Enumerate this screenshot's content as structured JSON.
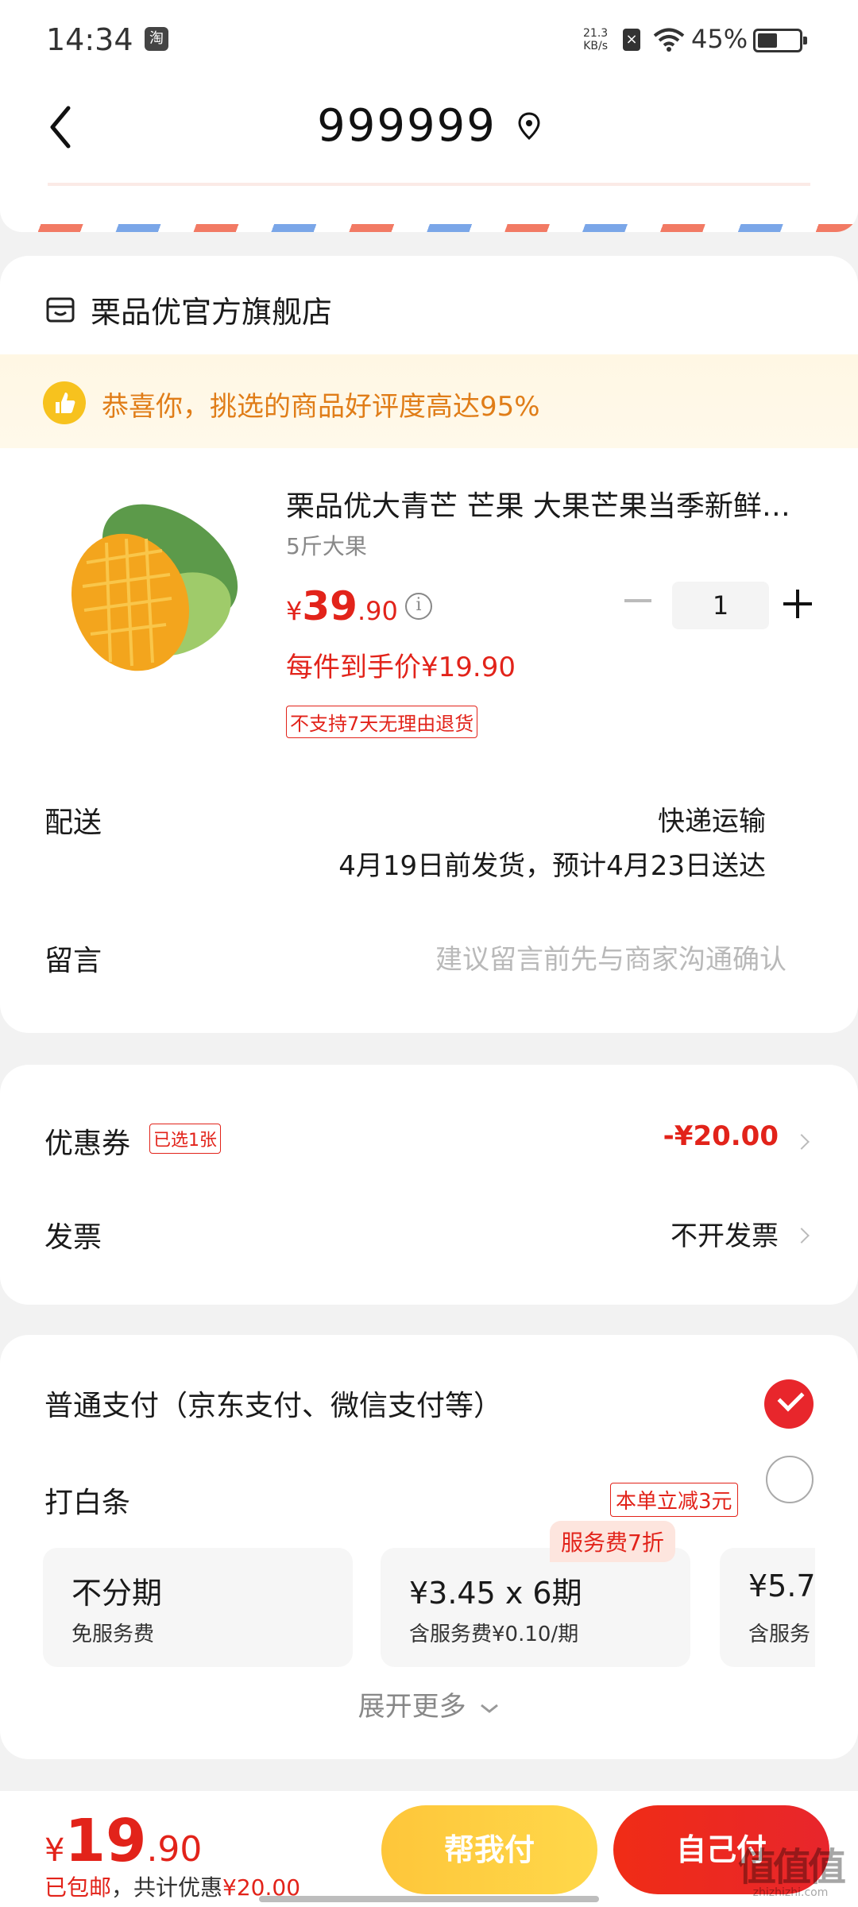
{
  "status_bar": {
    "time": "14:34",
    "app_badge": "淘",
    "net_speed": "21.3",
    "net_unit": "KB/s",
    "battery": "45%"
  },
  "header": {
    "title": "999999"
  },
  "store": {
    "name": "栗品优官方旗舰店"
  },
  "banner": {
    "text": "恭喜你，挑选的商品好评度高达95%"
  },
  "product": {
    "title": "栗品优大青芒 芒果 大果芒果当季新鲜水果",
    "spec": "5斤大果",
    "price_symbol": "¥",
    "price_int": "39",
    "price_dec": ".90",
    "quantity": "1",
    "unit_price": "每件到手价¥19.90",
    "return_tag": "不支持7天无理由退货"
  },
  "delivery": {
    "label": "配送",
    "method": "快递运输",
    "eta": "4月19日前发货，预计4月23日送达"
  },
  "message": {
    "label": "留言",
    "placeholder": "建议留言前先与商家沟通确认"
  },
  "coupon": {
    "label": "优惠券",
    "tag": "已选1张",
    "value": "-¥20.00"
  },
  "invoice": {
    "label": "发票",
    "value": "不开发票"
  },
  "payment": {
    "normal_label": "普通支付（京东支付、微信支付等）",
    "baitiao_label": "打白条",
    "baitiao_promo": "本单立减3元",
    "installments": [
      {
        "title": "不分期",
        "sub": "免服务费"
      },
      {
        "title": "¥3.45 x 6期",
        "sub": "含服务费¥0.10/期"
      },
      {
        "title": "¥5.7",
        "sub": "含服务"
      }
    ],
    "discount_badge": "服务费7折",
    "expand": "展开更多"
  },
  "bottom": {
    "yen": "¥",
    "total_int": "19",
    "total_dec": ".90",
    "note_shipping": "已包邮",
    "note_saving": "，共计优惠",
    "note_saving_amt": "¥20.00",
    "help_button": "帮我付",
    "pay_button": "自己付"
  },
  "watermark": {
    "text": "值值值",
    "sub": "zhizhizhi.com"
  },
  "colors": {
    "accent_red": "#e2231a",
    "pay_red": "#e8262c",
    "help_yellow": "#fec63a",
    "banner_orange": "#e07d18"
  }
}
